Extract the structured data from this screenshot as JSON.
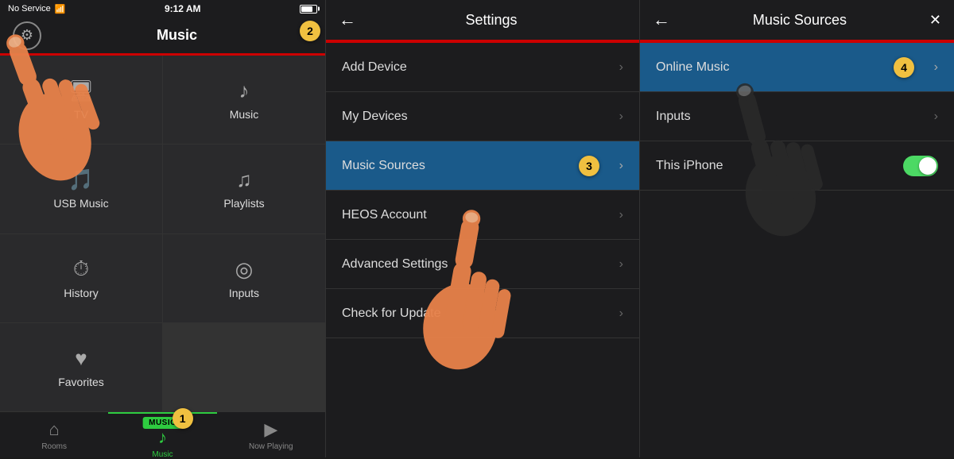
{
  "statusBar": {
    "carrier": "No Service",
    "wifi": "📶",
    "time": "9:12 AM",
    "battery": "80"
  },
  "panel1": {
    "title": "Music",
    "gearIcon": "⚙",
    "gridItems": [
      {
        "icon": "🖥",
        "label": "TV"
      },
      {
        "icon": "♪",
        "label": "Music"
      },
      {
        "icon": "🎵",
        "label": "USB Music"
      },
      {
        "icon": "♫",
        "label": "Playlists"
      },
      {
        "icon": "⏱",
        "label": "History"
      },
      {
        "icon": "◎",
        "label": "Inputs"
      },
      {
        "icon": "♥",
        "label": "Favorites"
      }
    ],
    "tabs": [
      {
        "id": "rooms",
        "icon": "⌂",
        "label": "Rooms"
      },
      {
        "id": "music",
        "icon": "♪",
        "label": "Music",
        "active": true,
        "badge": "MUSIC"
      },
      {
        "id": "nowplaying",
        "icon": "▶",
        "label": "Now Playing"
      }
    ],
    "stepBadge": "1"
  },
  "panel2": {
    "title": "Settings",
    "backIcon": "←",
    "items": [
      {
        "id": "add-device",
        "label": "Add Device",
        "active": false
      },
      {
        "id": "my-devices",
        "label": "My Devices",
        "active": false
      },
      {
        "id": "music-sources",
        "label": "Music Sources",
        "active": true
      },
      {
        "id": "heos-account",
        "label": "HEOS Account",
        "active": false
      },
      {
        "id": "advanced-settings",
        "label": "Advanced Settings",
        "active": false
      },
      {
        "id": "check-update",
        "label": "Check for Update",
        "active": false
      }
    ],
    "stepBadge": "3"
  },
  "panel3": {
    "title": "Music Sources",
    "backIcon": "←",
    "closeIcon": "✕",
    "items": [
      {
        "id": "online-music",
        "label": "Online Music",
        "active": true,
        "hasChevron": true
      },
      {
        "id": "inputs",
        "label": "Inputs",
        "active": false,
        "hasChevron": true
      },
      {
        "id": "this-iphone",
        "label": "This iPhone",
        "active": false,
        "hasToggle": true,
        "toggleOn": true
      }
    ],
    "stepBadge": "4"
  }
}
